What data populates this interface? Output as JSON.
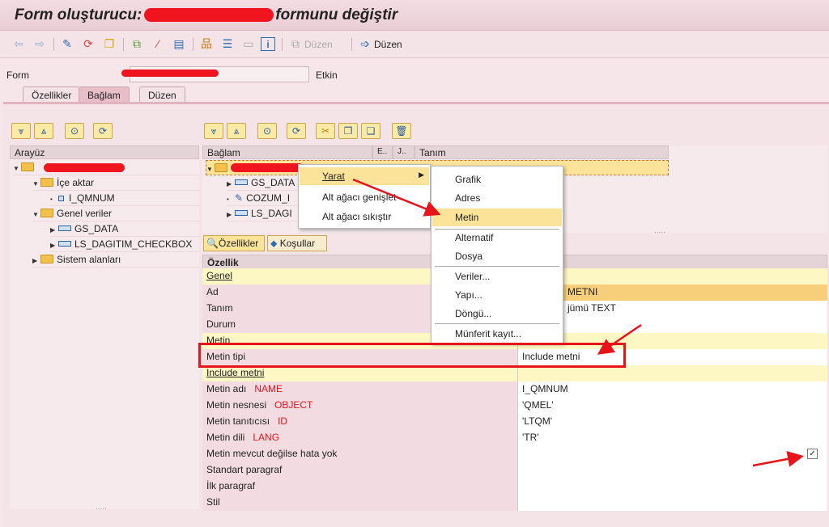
{
  "window": {
    "title_prefix": "Form oluşturucu:",
    "title_suffix": "formunu değiştir"
  },
  "toolbar": {
    "icons": [
      "back-icon",
      "forward-icon",
      "check-icon",
      "activate-icon",
      "copy-icon",
      "layout-icon",
      "magic-wand-icon",
      "print-preview-icon",
      "hierarchy-icon",
      "align-icon",
      "table-icon",
      "info-icon"
    ],
    "duzen_disabled": "Düzen",
    "duzen": "Düzen"
  },
  "form": {
    "label": "Form",
    "status": "Etkin"
  },
  "tabs": [
    {
      "label": "Özellikler"
    },
    {
      "label": "Bağlam",
      "active": true
    },
    {
      "label": "Düzen"
    }
  ],
  "left_panel": {
    "header": "Arayüz",
    "rows": [
      {
        "label": "İçe aktar"
      },
      {
        "label": "I_QMNUM"
      },
      {
        "label": "Genel veriler"
      },
      {
        "label": "GS_DATA"
      },
      {
        "label": "LS_DAGITIM_CHECKBOX"
      },
      {
        "label": "Sistem alanları"
      }
    ],
    "footer": "....."
  },
  "right_tree": {
    "columns": [
      "Bağlam",
      "E..",
      "J..",
      "Tanım"
    ],
    "rows": [
      {
        "label": "GS_DATA"
      },
      {
        "label": "COZUM_I"
      },
      {
        "label": "LS_DAGI"
      }
    ],
    "footer": "....."
  },
  "subtabs": {
    "ozellikler": "Özellikler",
    "kosullar": "Koşullar"
  },
  "properties": {
    "header": "Özellik",
    "rows": [
      {
        "key": "Genel",
        "value": "",
        "section": true
      },
      {
        "key": "Ad",
        "value": "METNI"
      },
      {
        "key": "Tanım",
        "value": "jümü TEXT"
      },
      {
        "key": "Durum",
        "value": ""
      },
      {
        "key": "Metin",
        "value": "",
        "section": true
      },
      {
        "key": "Metin tipi",
        "value": "Include metni"
      },
      {
        "key": "Include metni",
        "value": "",
        "section": true
      },
      {
        "key": "Metin adı",
        "note": "NAME",
        "value": "I_QMNUM"
      },
      {
        "key": "Metin nesnesi",
        "note": "OBJECT",
        "value": "'QMEL'"
      },
      {
        "key": "Metin tanıtıcısı",
        "note": "ID",
        "value": "'LTQM'"
      },
      {
        "key": "Metin dili",
        "note": "LANG",
        "value": "'TR'"
      },
      {
        "key": "Metin mevcut değilse hata yok",
        "value": "",
        "checkbox": true,
        "checked": true
      },
      {
        "key": "Standart paragraf",
        "value": ""
      },
      {
        "key": "İlk paragraf",
        "value": ""
      },
      {
        "key": "Stil",
        "value": ""
      }
    ]
  },
  "context_menu": {
    "items": [
      "Yarat",
      "Alt ağacı genişlet",
      "Alt ağacı sıkıştır"
    ]
  },
  "submenu": {
    "items": [
      "Grafik",
      "Adres",
      "Metin",
      "Alternatif",
      "Dosya",
      "Veriler...",
      "Yapı...",
      "Döngü...",
      "Münferit kayıt..."
    ]
  },
  "colors": {
    "annotation": "#e8141c",
    "highlight": "#fbe39a",
    "section": "#fdf7c4",
    "key_bg": "#f3dce1"
  }
}
